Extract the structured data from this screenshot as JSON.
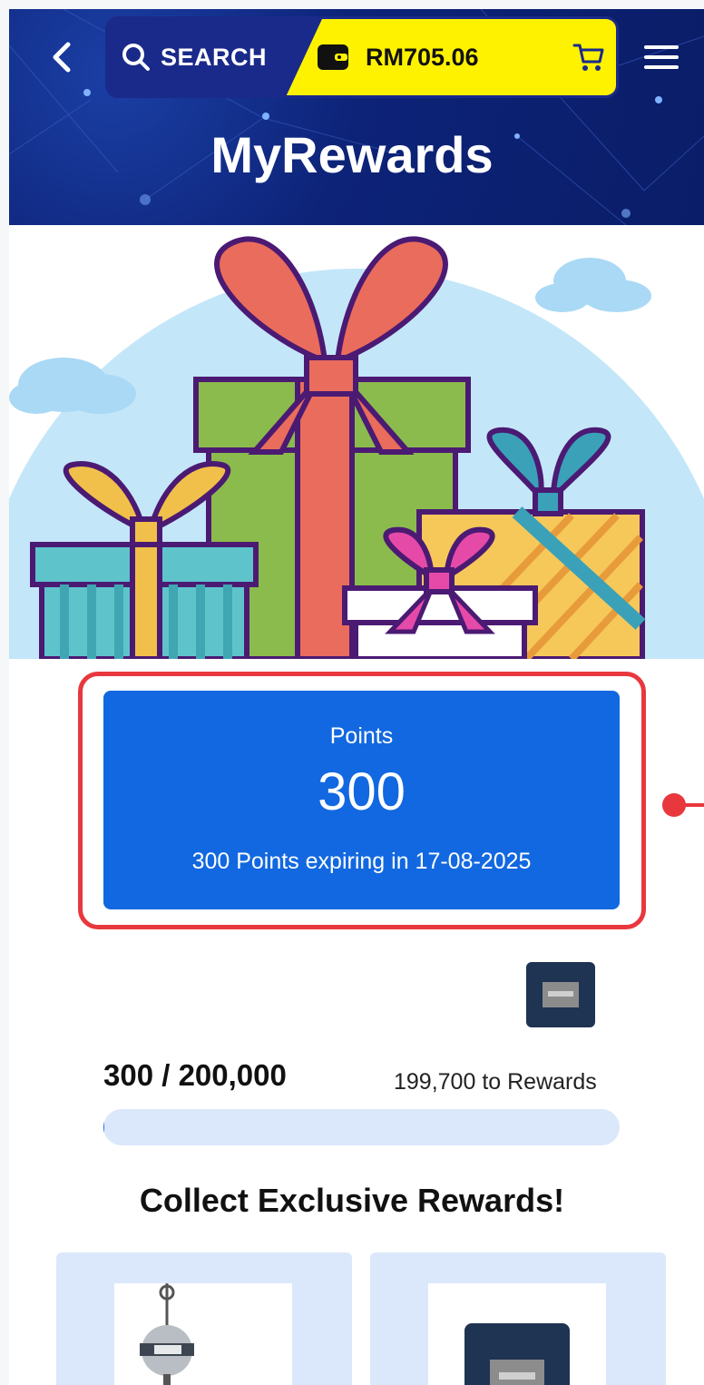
{
  "header": {
    "search_label": "SEARCH",
    "wallet_balance": "RM705.06",
    "title": "MyRewards"
  },
  "points_card": {
    "label": "Points",
    "value": "300",
    "expiry_text": "300 Points expiring in 17-08-2025"
  },
  "progress": {
    "text": "300 / 200,000",
    "remaining_text": "199,700 to Rewards",
    "fraction": 0.0015
  },
  "section": {
    "title": "Collect Exclusive Rewards!"
  },
  "colors": {
    "header_bg": "#0a1d68",
    "search_bg": "#1a2a8a",
    "wallet_bg": "#fff200",
    "card_blue": "#1268e0",
    "highlight_red": "#e8383d",
    "tile_bg": "#dbe8fb"
  },
  "icons": [
    "chevron-left-icon",
    "search-icon",
    "wallet-icon",
    "cart-icon",
    "hamburger-menu-icon"
  ]
}
